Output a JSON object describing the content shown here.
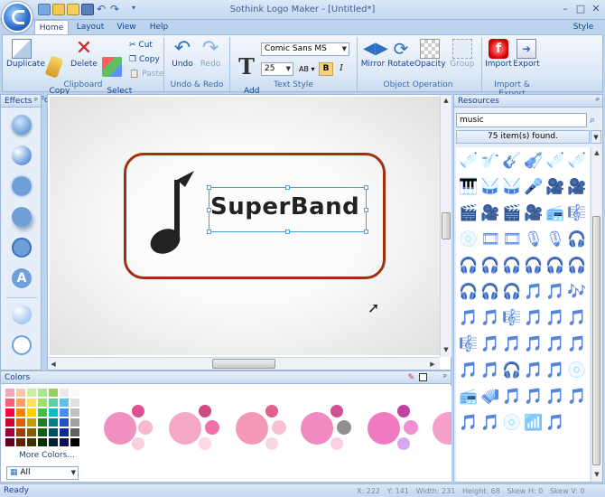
{
  "window": {
    "title": "Sothink Logo Maker - [Untitled*]",
    "controls": {
      "min": "–",
      "max": "□",
      "close": "✕"
    },
    "style_label": "Style"
  },
  "tabs": [
    {
      "label": "Home",
      "active": true
    },
    {
      "label": "Layout"
    },
    {
      "label": "View"
    },
    {
      "label": "Help"
    }
  ],
  "ribbon": {
    "clipboard": {
      "label": "Clipboard",
      "duplicate": "Duplicate",
      "copy_format": "Copy\nFormat",
      "delete": "Delete",
      "select_all": "Select\nAll",
      "cut": "Cut",
      "copy": "Copy",
      "paste": "Paste"
    },
    "undo_redo": {
      "label": "Undo & Redo",
      "undo": "Undo",
      "redo": "Redo"
    },
    "text_style": {
      "label": "Text Style",
      "add_text": "Add\nText",
      "font": "Comic Sans MS",
      "size": "25",
      "bold": "B",
      "italic": "I",
      "ab": "AB"
    },
    "object_operation": {
      "label": "Object Operation",
      "mirror": "Mirror",
      "rotate": "Rotate",
      "opacity": "Opacity",
      "group": "Group"
    },
    "import_export": {
      "label": "Import & Export",
      "import": "Import",
      "export": "Export"
    }
  },
  "effects": {
    "title": "Effects",
    "a_icon_text": "A"
  },
  "canvas": {
    "logo_text": "SuperBand"
  },
  "colors": {
    "title": "Colors",
    "more_colors": "More Colors...",
    "filter": "All",
    "palette": [
      "#f4a8c0",
      "#f8c8a8",
      "#c8f0a0",
      "#a8e890",
      "#98d068",
      "#e8e8e8",
      "#f8f8f8",
      "#ff6080",
      "#ffa060",
      "#ffe060",
      "#a0e060",
      "#60d0a0",
      "#60c0f0",
      "#e0e0e0",
      "#ff0040",
      "#ff8000",
      "#ffd000",
      "#40c040",
      "#00c0c0",
      "#4090ff",
      "#c0c0c0",
      "#d00030",
      "#e06000",
      "#c0a000",
      "#208020",
      "#008080",
      "#2050d0",
      "#a0a0a0",
      "#a00040",
      "#a04000",
      "#806000",
      "#106010",
      "#005060",
      "#102890",
      "#606060",
      "#600020",
      "#602000",
      "#403000",
      "#003000",
      "#002030",
      "#101050",
      "#000000"
    ]
  },
  "resources": {
    "title": "Resources",
    "search_value": "music",
    "found": "75 item(s) found."
  },
  "status": {
    "ready": "Ready",
    "coords": "X: 222   Y: 141   Width: 231   Height: 68   Skew H: 0   Skew V: 0"
  }
}
